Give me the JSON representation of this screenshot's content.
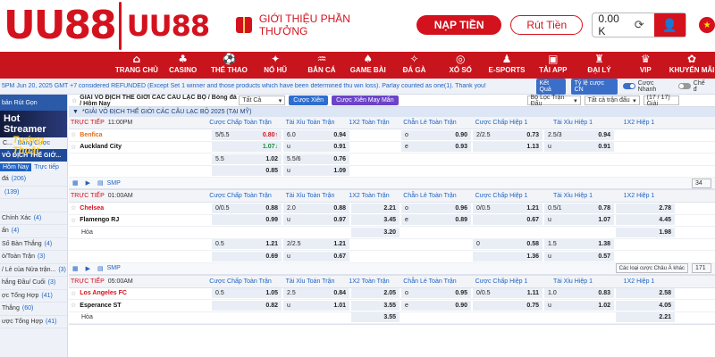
{
  "brand": {
    "logo_big": "UU88",
    "logo_small": "UU88"
  },
  "header": {
    "promo": "GIỚI THIỆU PHẦN THƯỞNG",
    "deposit": "NẠP TIỀN",
    "withdraw": "Rút Tiền",
    "balance": "0.00 K"
  },
  "nav": [
    {
      "icon": "⌂",
      "label": "TRANG CHỦ"
    },
    {
      "icon": "♣",
      "label": "CASINO"
    },
    {
      "icon": "⚽",
      "label": "THỂ THAO"
    },
    {
      "icon": "✦",
      "label": "NỔ HŨ"
    },
    {
      "icon": "♒",
      "label": "BẮN CÁ"
    },
    {
      "icon": "♠",
      "label": "GAME BÀI"
    },
    {
      "icon": "✧",
      "label": "ĐÁ GÀ"
    },
    {
      "icon": "◎",
      "label": "XỔ SỐ"
    },
    {
      "icon": "♟",
      "label": "E-SPORTS"
    },
    {
      "icon": "▣",
      "label": "TẢI APP"
    },
    {
      "icon": "♜",
      "label": "ĐẠI LÝ"
    },
    {
      "icon": "♛",
      "label": "VIP"
    },
    {
      "icon": "✿",
      "label": "KHUYẾN MÃI"
    }
  ],
  "ticker": {
    "time": "5PM Jun 20, 2025 GMT +7",
    "message": "considered REFUNDED (Except Set 1 winner and those products which have been determined thu win loss). Parlay counted as one(1). Thank you!",
    "btn_result": "Kết Quả",
    "btn_odds": "Tỷ lệ cược CN",
    "quick_label": "Cược Nhanh",
    "mode_label": "Chế đ"
  },
  "sidebar": {
    "top": "bản Rút Gọn",
    "banner_line1": "Hot Streamer",
    "banner_line2": "Tướng Thuật",
    "tab_a": "C...",
    "tab_b": "Bảng Cược",
    "section": "VÔ ĐỊCH THẾ GIỚ...",
    "sub_today": "Hôm Nay",
    "sub_early": "Trực tiếp",
    "items": [
      {
        "label": "đá",
        "count": "(206)"
      },
      {
        "label": "",
        "count": "(139)"
      },
      {
        "label": "",
        "count": ""
      },
      {
        "label": "Chính Xác",
        "count": "(4)"
      },
      {
        "label": "ấn",
        "count": "(4)"
      },
      {
        "label": "Số Bàn Thắng",
        "count": "(4)"
      },
      {
        "label": "ò/Toàn Trận",
        "count": "(3)"
      },
      {
        "label": "/ Lẻ của Nửa trận...",
        "count": "(3)"
      },
      {
        "label": "hắng Đầu/ Cuối",
        "count": "(3)"
      },
      {
        "label": "ợc Tổng Hợp",
        "count": "(41)"
      },
      {
        "label": "Thắng",
        "count": "(60)"
      },
      {
        "label": "ược Tổng Hợp",
        "count": "(41)"
      }
    ]
  },
  "main": {
    "title": "GIẢI VÔ ĐỊCH THẾ GIỚI CÁC CÂU LẠC BỘ / Bóng đá / Hôm Nay",
    "filter_all": "Tất Cả",
    "parlay": "Cược Xiên",
    "parlay_luck": "Cược Xiên May Mắn",
    "filter_league": "Bộ Lọc Trận Đấu",
    "filter_matches": "Tất cả trận đấu",
    "page": "(17 / 17) Giải",
    "league": "*GIẢI VÔ ĐỊCH THẾ GIỚI CÁC CÂU LẠC BỘ 2025 (TẠI MỸ)",
    "columns": [
      "Cược Chấp Toàn Trận",
      "Tài Xỉu Toàn Trận",
      "1X2 Toàn Trận",
      "Chẵn Lẻ Toàn Trận",
      "Cược Chấp Hiệp 1",
      "Tài Xỉu Hiệp 1",
      "1X2 Hiệp 1"
    ],
    "live_label": "TRỰC TIẾP",
    "draw_label": "Hòa",
    "smp": "SMP",
    "matches": [
      {
        "time": "11:00PM",
        "home": "Benfica",
        "away": "Auckland City",
        "rows": [
          [
            "5/5.5",
            "0.80↑",
            "6.0",
            "0.94",
            "",
            "o",
            "0.90",
            "2/2.5",
            "0.73",
            "2.5/3",
            "0.94",
            ""
          ],
          [
            "",
            "1.07↓",
            "u",
            "0.91",
            "",
            "e",
            "0.93",
            "",
            "1.13",
            "u",
            "0.91",
            ""
          ],
          [
            "5.5",
            "1.02",
            "5.5/6",
            "0.76",
            "",
            "",
            "",
            "",
            "",
            "",
            "",
            ""
          ],
          [
            "",
            "0.85",
            "u",
            "1.09",
            "",
            "",
            "",
            "",
            "",
            "",
            "",
            ""
          ]
        ],
        "more": "34"
      },
      {
        "time": "01:00AM",
        "home": "Chelsea",
        "away": "Flamengo RJ",
        "rows": [
          [
            "0/0.5",
            "0.88",
            "2.0",
            "0.88",
            "2.21",
            "o",
            "0.96",
            "0/0.5",
            "1.21",
            "0.5/1",
            "0.78",
            "2.78"
          ],
          [
            "",
            "0.99",
            "u",
            "0.97",
            "3.45",
            "e",
            "0.89",
            "",
            "0.67",
            "u",
            "1.07",
            "4.45"
          ],
          [
            "",
            "",
            "",
            "",
            "3.20",
            "",
            "",
            "",
            "",
            "",
            "",
            "1.98"
          ],
          [
            "0.5",
            "1.21",
            "2/2.5",
            "1.21",
            "",
            "",
            "",
            "0",
            "0.58",
            "1.5",
            "1.38",
            ""
          ],
          [
            "",
            "0.69",
            "u",
            "0.67",
            "",
            "",
            "",
            "",
            "1.36",
            "u",
            "0.57",
            ""
          ]
        ],
        "more": "171",
        "bet_type": "Các loại cược Châu Á khác"
      },
      {
        "time": "05:00AM",
        "home": "Los Angeles FC",
        "away": "Esperance ST",
        "rows": [
          [
            "0.5",
            "1.05",
            "2.5",
            "0.84",
            "2.05",
            "o",
            "0.95",
            "0/0.5",
            "1.11",
            "1.0",
            "0.83",
            "2.58"
          ],
          [
            "",
            "0.82",
            "u",
            "1.01",
            "3.55",
            "e",
            "0.90",
            "",
            "0.75",
            "u",
            "1.02",
            "4.05"
          ],
          [
            "",
            "",
            "",
            "",
            "3.55",
            "",
            "",
            "",
            "",
            "",
            "",
            "2.21"
          ]
        ]
      }
    ]
  }
}
